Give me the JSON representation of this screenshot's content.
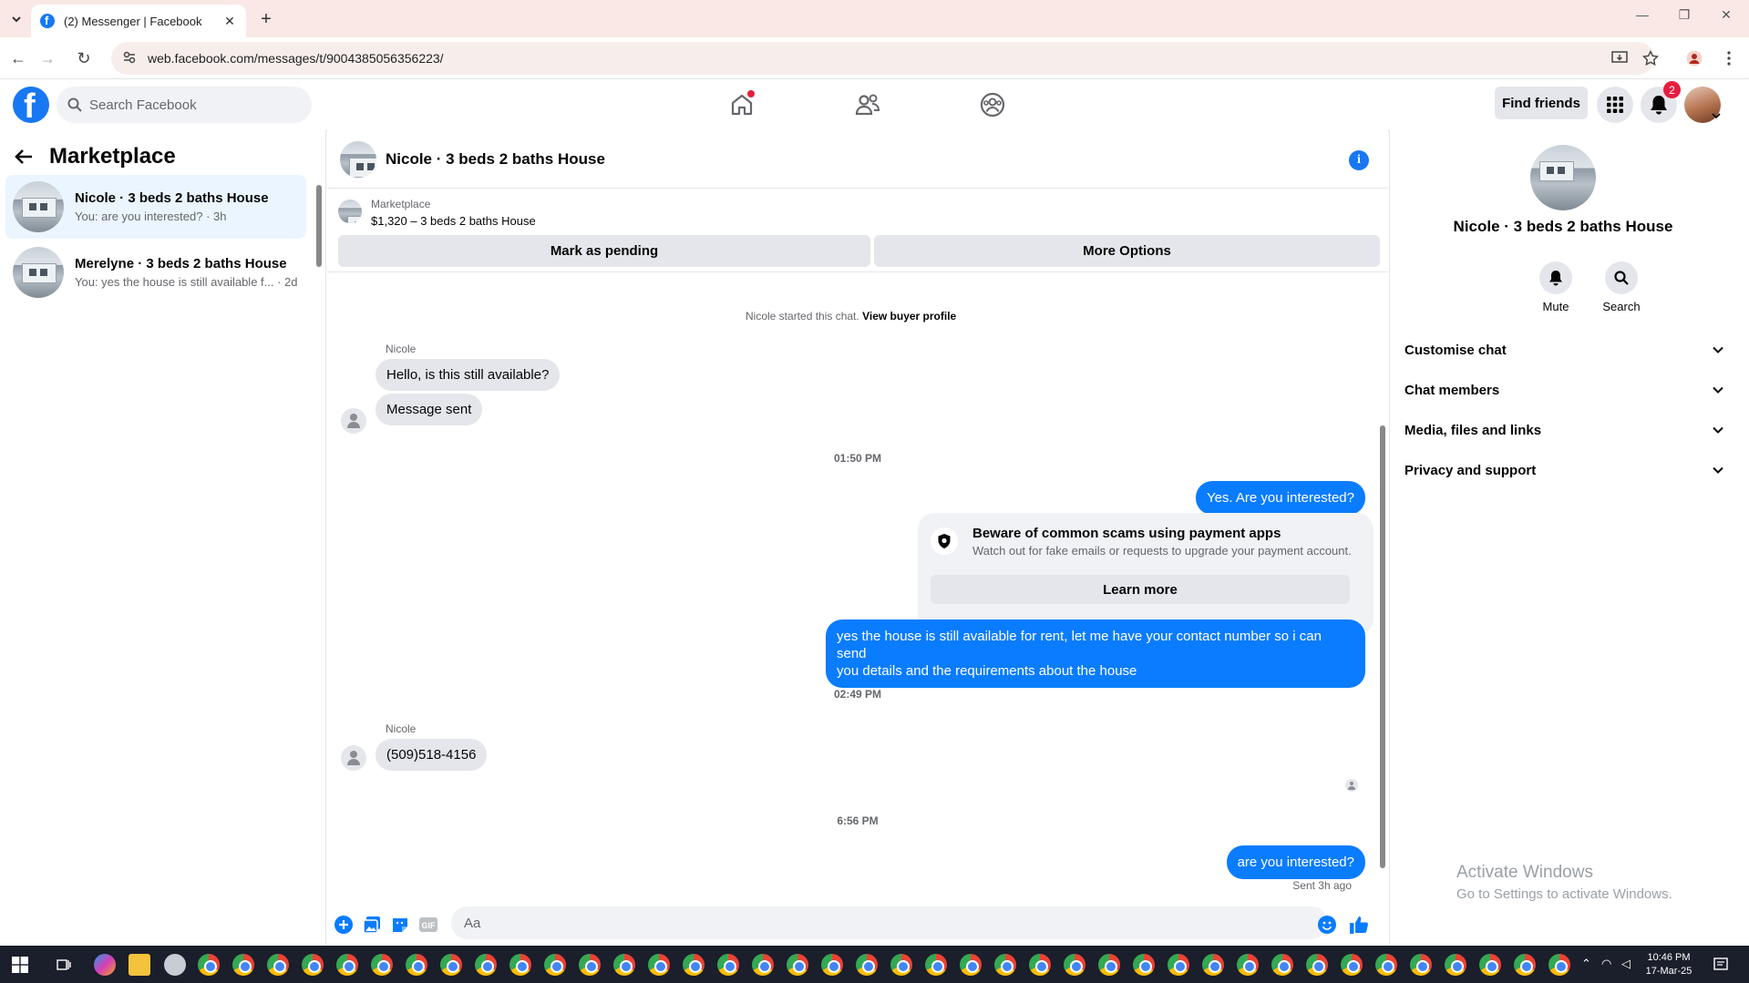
{
  "browser": {
    "tab_title": "(2) Messenger | Facebook",
    "url": "web.facebook.com/messages/t/9004385056356223/"
  },
  "fb": {
    "search_placeholder": "Search Facebook",
    "find_friends_label": "Find friends",
    "notifications_count": "2"
  },
  "left_panel": {
    "title": "Marketplace",
    "conversations": [
      {
        "name": "Nicole · 3 beds 2 baths House",
        "preview": "You: are you interested? · 3h",
        "active": true
      },
      {
        "name": "Merelyne · 3 beds 2 baths House",
        "preview": "You: yes the house is still available f... · 2d",
        "active": false
      }
    ]
  },
  "chat": {
    "title": "Nicole · 3 beds 2 baths House",
    "marketplace_label": "Marketplace",
    "listing": "$1,320 – 3 beds 2 baths House",
    "mark_pending_label": "Mark as pending",
    "more_options_label": "More Options",
    "started_text": "Nicole started this chat.",
    "view_buyer_label": "View buyer profile",
    "sender1": "Nicole",
    "msg_in_1": "Hello, is this still available?",
    "msg_in_2": "Message sent",
    "time1": "01:50 PM",
    "msg_out_1": "Yes. Are you interested?",
    "scam_title": "Beware of common scams using payment apps",
    "scam_text": "Watch out for fake emails or requests to upgrade your payment account.",
    "learn_more_label": "Learn more",
    "msg_out_2_line1": "yes the house is still available for rent, let me have your contact number so i can send",
    "msg_out_2_line2": "you details and the requirements about the house",
    "time2": "02:49 PM",
    "sender2": "Nicole",
    "msg_in_3": "(509)518-4156",
    "time3": "6:56 PM",
    "msg_out_3": "are you interested?",
    "sent_status": "Sent 3h ago",
    "composer_placeholder": "Aa"
  },
  "right_panel": {
    "name": "Nicole · 3 beds 2 baths House",
    "mute_label": "Mute",
    "search_label": "Search",
    "sections": [
      "Customise chat",
      "Chat members",
      "Media, files and links",
      "Privacy and support"
    ]
  },
  "watermark": {
    "line1": "Activate Windows",
    "line2": "Go to Settings to activate Windows."
  },
  "taskbar": {
    "time": "10:46 PM",
    "date": "17-Mar-25"
  },
  "colors": {
    "brand": "#1877f2",
    "outgoing_bubble": "#0a7cff",
    "incoming_bubble": "#e4e6eb",
    "active_conversation": "#ebf5ff"
  },
  "icons": [
    "facebook-logo",
    "search-icon",
    "home-icon",
    "friends-icon",
    "groups-icon",
    "menu-grid-icon",
    "bell-icon",
    "back-arrow-icon",
    "info-icon",
    "shield-icon",
    "plus-icon",
    "photo-icon",
    "sticker-icon",
    "gif-icon",
    "emoji-icon",
    "like-icon",
    "chevron-down-icon"
  ]
}
